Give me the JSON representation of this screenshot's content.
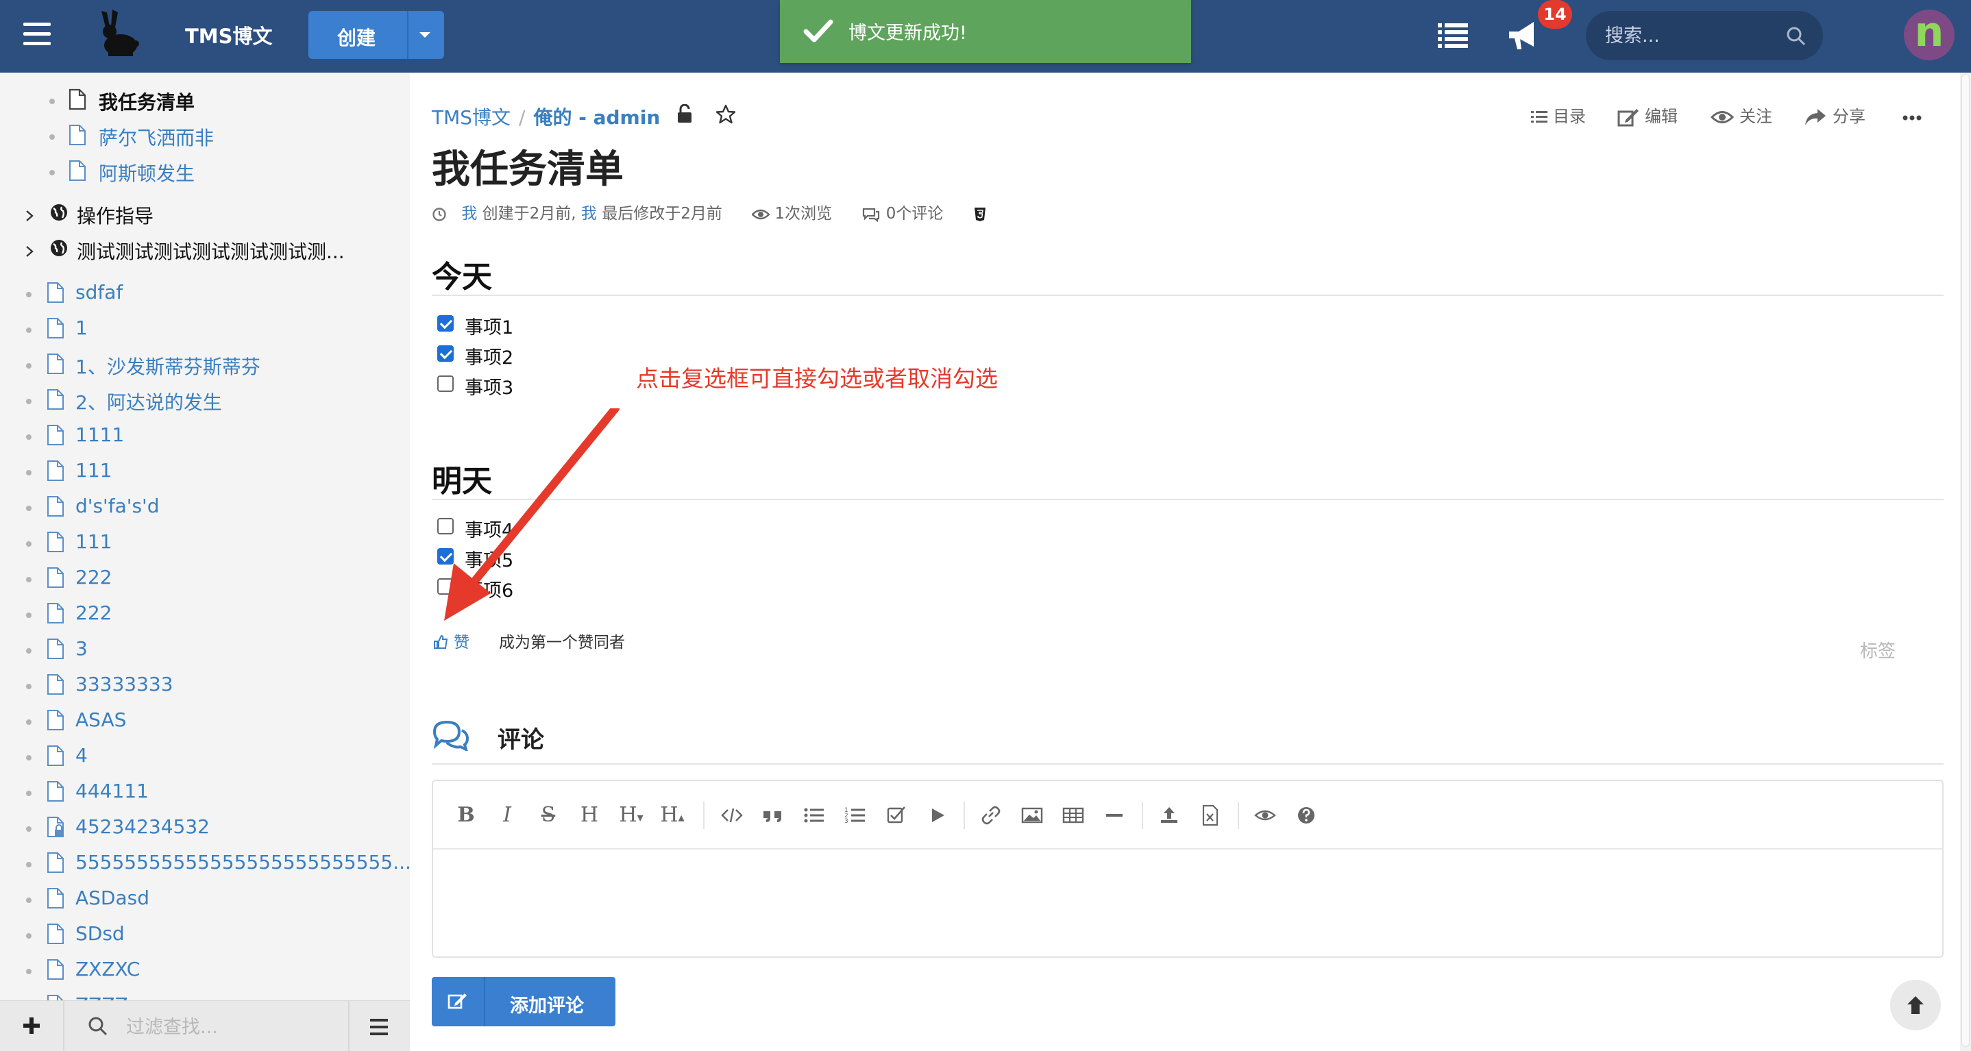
{
  "topbar": {
    "brand": "TMS博文",
    "create_label": "创建",
    "toast": "博文更新成功!",
    "notifications_count": "14",
    "search_placeholder": "搜索...",
    "avatar_letter": "n"
  },
  "sidebar": {
    "items": [
      {
        "kind": "child",
        "label": "我任务清单",
        "active": true
      },
      {
        "kind": "child",
        "label": "萨尔飞洒而非"
      },
      {
        "kind": "child",
        "label": "阿斯顿发生"
      },
      {
        "kind": "folder",
        "label": "操作指导"
      },
      {
        "kind": "folder",
        "label": "测试测试测试测试测试测试测..."
      },
      {
        "kind": "doc",
        "label": "sdfaf"
      },
      {
        "kind": "doc",
        "label": "1"
      },
      {
        "kind": "doc",
        "label": "1、沙发斯蒂芬斯蒂芬"
      },
      {
        "kind": "doc",
        "label": "2、阿达说的发生"
      },
      {
        "kind": "doc",
        "label": "1111"
      },
      {
        "kind": "doc",
        "label": "111"
      },
      {
        "kind": "doc",
        "label": "d's'fa's'd"
      },
      {
        "kind": "doc",
        "label": "111"
      },
      {
        "kind": "doc",
        "label": "222"
      },
      {
        "kind": "doc",
        "label": "222"
      },
      {
        "kind": "doc",
        "label": "3"
      },
      {
        "kind": "doc",
        "label": "33333333"
      },
      {
        "kind": "doc",
        "label": "ASAS"
      },
      {
        "kind": "doc",
        "label": "4"
      },
      {
        "kind": "doc",
        "label": "444111"
      },
      {
        "kind": "doc-locked",
        "label": "45234234532"
      },
      {
        "kind": "doc",
        "label": "55555555555555555555555555..."
      },
      {
        "kind": "doc",
        "label": "ASDasd"
      },
      {
        "kind": "doc",
        "label": "SDsd"
      },
      {
        "kind": "doc",
        "label": "ZXZXC"
      },
      {
        "kind": "doc",
        "label": "ZZZZ"
      }
    ],
    "filter_placeholder": "过滤查找..."
  },
  "main": {
    "breadcrumb": {
      "root": "TMS博文",
      "space": "俺的 - admin"
    },
    "actions": {
      "toc": "目录",
      "edit": "编辑",
      "watch": "关注",
      "share": "分享"
    },
    "title": "我任务清单",
    "meta": {
      "me1": "我",
      "created": "创建于2月前,",
      "me2": "我",
      "modified": "最后修改于2月前",
      "views": "1次浏览",
      "comments": "0个评论"
    },
    "sections": [
      {
        "heading": "今天",
        "tasks": [
          {
            "label": "事项1",
            "checked": true
          },
          {
            "label": "事项2",
            "checked": true
          },
          {
            "label": "事项3",
            "checked": false
          }
        ]
      },
      {
        "heading": "明天",
        "tasks": [
          {
            "label": "事项4",
            "checked": false
          },
          {
            "label": "事项5",
            "checked": true
          },
          {
            "label": "事项6",
            "checked": false
          }
        ]
      }
    ],
    "annotation": "点击复选框可直接勾选或者取消勾选",
    "like_label": "赞",
    "like_hint": "成为第一个赞同者",
    "tags_label": "标签",
    "comments_heading": "评论",
    "add_comment_label": "添加评论"
  },
  "colors": {
    "topbar": "#2d4f7f",
    "accent": "#3a7fd0",
    "toast": "#5fa45c",
    "annotation": "#e53a2b",
    "badge": "#e23b2e"
  }
}
